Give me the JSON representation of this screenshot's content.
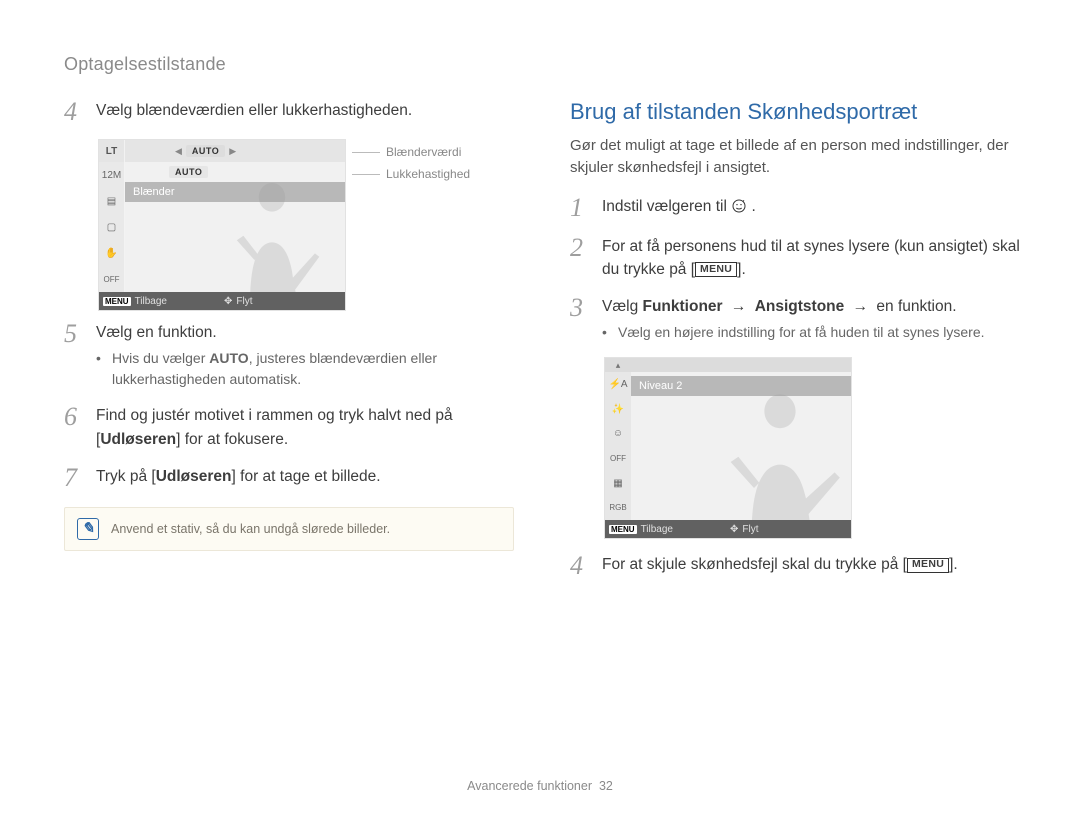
{
  "breadcrumb": "Optagelsestilstande",
  "left": {
    "step4": {
      "num": "4",
      "text": "Vælg blændeværdien eller lukkerhastigheden."
    },
    "lcd": {
      "top_lt": "LT",
      "auto1": "AUTO",
      "auto2": "AUTO",
      "res": "12M",
      "label_bar": "Blænder",
      "bottom_menu": "MENU",
      "bottom_back": "Tilbage",
      "bottom_move": "Flyt",
      "callout1": "Blænderværdi",
      "callout2": "Lukkehastighed"
    },
    "step5": {
      "num": "5",
      "text": "Vælg en funktion.",
      "bullet_prefix": "Hvis du vælger ",
      "bullet_bold": "AUTO",
      "bullet_suffix": ", justeres blændeværdien eller lukkerhastigheden automatisk."
    },
    "step6": {
      "num": "6",
      "text_a": "Find og justér motivet i rammen og tryk halvt ned på [",
      "text_bold": "Udløseren",
      "text_b": "] for at fokusere."
    },
    "step7": {
      "num": "7",
      "text_a": "Tryk på [",
      "text_bold": "Udløseren",
      "text_b": "] for at tage et billede."
    },
    "note": "Anvend et stativ, så du kan undgå slørede billeder."
  },
  "right": {
    "title": "Brug af tilstanden Skønhedsportræt",
    "lead": "Gør det muligt at tage et billede af en person med indstillinger, der skjuler skønhedsfejl i ansigtet.",
    "step1": {
      "num": "1",
      "text_a": "Indstil vælgeren til ",
      "text_b": "."
    },
    "step2": {
      "num": "2",
      "text_a": "For at få personens hud til at synes lysere (kun ansigtet) skal du trykke på [",
      "menu": "MENU",
      "text_b": "]."
    },
    "step3": {
      "num": "3",
      "text_a": "Vælg ",
      "b1": "Funktioner",
      "arrow": "→",
      "b2": "Ansigtstone",
      "text_b": " en funktion.",
      "bullet": "Vælg en højere indstilling for at få huden til at synes lysere."
    },
    "lcd": {
      "niveau": "Niveau 2",
      "bottom_menu": "MENU",
      "bottom_back": "Tilbage",
      "bottom_move": "Flyt"
    },
    "step4": {
      "num": "4",
      "text_a": "For at skjule skønhedsfejl skal du trykke på [",
      "menu": "MENU",
      "text_b": "]."
    }
  },
  "footer": {
    "section": "Avancerede funktioner",
    "page": "32"
  }
}
